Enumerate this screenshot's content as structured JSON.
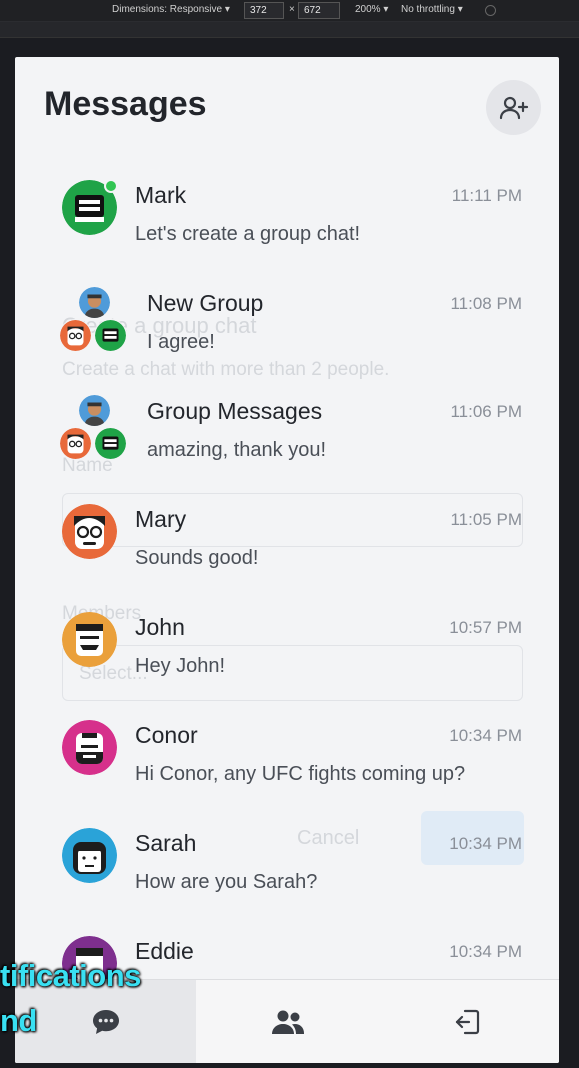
{
  "devtools": {
    "dimensions_label": "Dimensions: Responsive",
    "width": "372",
    "times": "×",
    "height": "672",
    "zoom": "200%",
    "throttle": "No throttling"
  },
  "page": {
    "title": "Messages",
    "add_button_icon": "user-plus-icon"
  },
  "conversations": [
    {
      "name": "Mark",
      "preview": "Let's create a group chat!",
      "time": "11:11 PM",
      "online": true,
      "avatar": "green-robot-avatar"
    },
    {
      "name": "New Group",
      "preview": "I agree!",
      "time": "11:08 PM",
      "group": true
    },
    {
      "name": "Group Messages",
      "preview": "amazing, thank you!",
      "time": "11:06 PM",
      "group": true
    },
    {
      "name": "Mary",
      "preview": "Sounds good!",
      "time": "11:05 PM",
      "avatar": "orange-glasses-avatar"
    },
    {
      "name": "John",
      "preview": "Hey John!",
      "time": "10:57 PM",
      "avatar": "yellow-mustache-avatar"
    },
    {
      "name": "Conor",
      "preview": "Hi Conor, any UFC fights coming up?",
      "time": "10:34 PM",
      "avatar": "pink-beard-avatar"
    },
    {
      "name": "Sarah",
      "preview": "How are you Sarah?",
      "time": "10:34 PM",
      "avatar": "blue-hair-avatar"
    },
    {
      "name": "Eddie",
      "preview": "",
      "time": "10:34 PM",
      "avatar": "purple-avatar"
    }
  ],
  "ghost_modal": {
    "title": "Create a group chat",
    "subtitle": "Create a chat with more than 2 people.",
    "name_label": "Name",
    "members_label": "Members",
    "select_placeholder": "Select...",
    "cancel": "Cancel"
  },
  "nav": {
    "chats_icon": "chat-bubble-icon",
    "people_icon": "people-icon",
    "logout_icon": "logout-icon"
  },
  "caption": {
    "line1": "tifications",
    "line2": "nd"
  },
  "colors": {
    "mark_green": "#1fa347",
    "mary_orange": "#e8693a",
    "john_yellow": "#eaa03b",
    "conor_pink": "#d6308b",
    "sarah_blue": "#2aa3d8",
    "eddie_purple": "#7e2f8e",
    "caption_cyan": "#39e0f2"
  }
}
